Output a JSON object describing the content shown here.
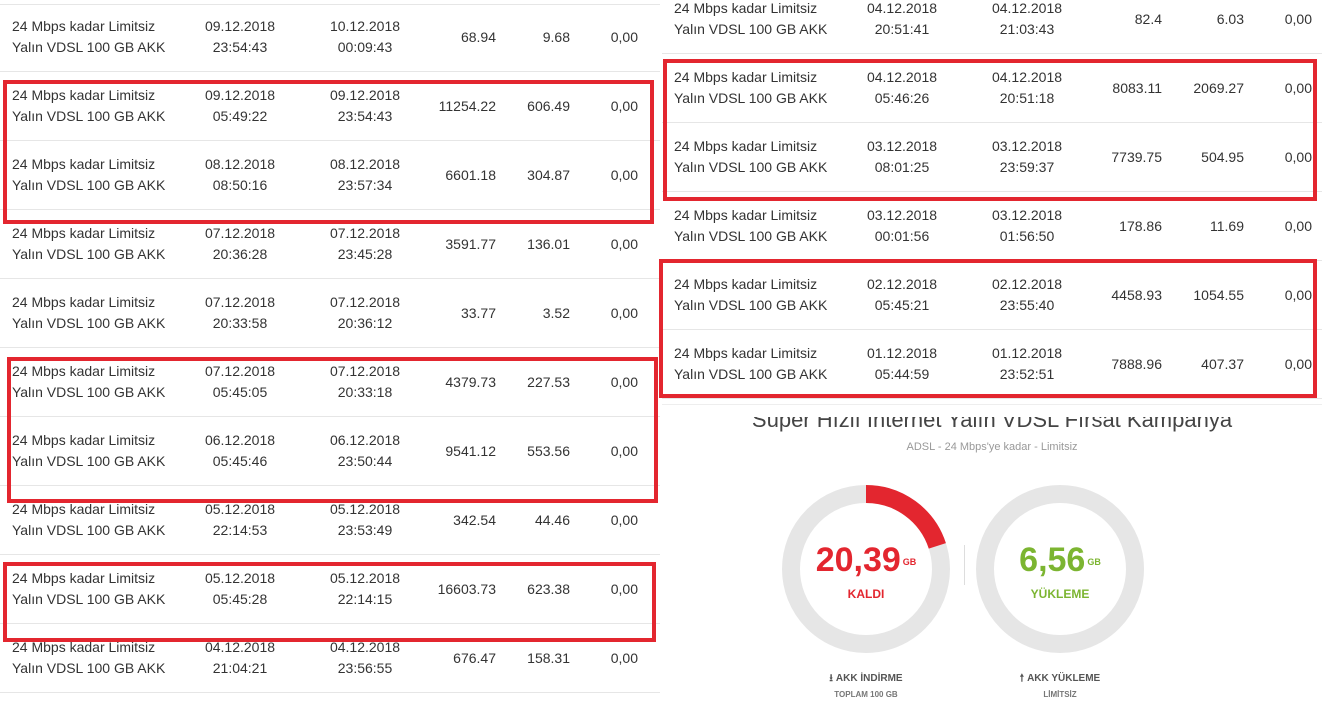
{
  "left_rows": [
    {
      "pkg1": "24 Mbps kadar Limitsiz",
      "pkg2": "Yalın VDSL 100 GB AKK",
      "sd": "09.12.2018",
      "st": "23:54:43",
      "ed": "10.12.2018",
      "et": "00:09:43",
      "dl": "68.94",
      "ul": "9.68",
      "fee": "0,00"
    },
    {
      "pkg1": "24 Mbps kadar Limitsiz",
      "pkg2": "Yalın VDSL 100 GB AKK",
      "sd": "09.12.2018",
      "st": "05:49:22",
      "ed": "09.12.2018",
      "et": "23:54:43",
      "dl": "11254.22",
      "ul": "606.49",
      "fee": "0,00"
    },
    {
      "pkg1": "24 Mbps kadar Limitsiz",
      "pkg2": "Yalın VDSL 100 GB AKK",
      "sd": "08.12.2018",
      "st": "08:50:16",
      "ed": "08.12.2018",
      "et": "23:57:34",
      "dl": "6601.18",
      "ul": "304.87",
      "fee": "0,00"
    },
    {
      "pkg1": "24 Mbps kadar Limitsiz",
      "pkg2": "Yalın VDSL 100 GB AKK",
      "sd": "07.12.2018",
      "st": "20:36:28",
      "ed": "07.12.2018",
      "et": "23:45:28",
      "dl": "3591.77",
      "ul": "136.01",
      "fee": "0,00"
    },
    {
      "pkg1": "24 Mbps kadar Limitsiz",
      "pkg2": "Yalın VDSL 100 GB AKK",
      "sd": "07.12.2018",
      "st": "20:33:58",
      "ed": "07.12.2018",
      "et": "20:36:12",
      "dl": "33.77",
      "ul": "3.52",
      "fee": "0,00"
    },
    {
      "pkg1": "24 Mbps kadar Limitsiz",
      "pkg2": "Yalın VDSL 100 GB AKK",
      "sd": "07.12.2018",
      "st": "05:45:05",
      "ed": "07.12.2018",
      "et": "20:33:18",
      "dl": "4379.73",
      "ul": "227.53",
      "fee": "0,00"
    },
    {
      "pkg1": "24 Mbps kadar Limitsiz",
      "pkg2": "Yalın VDSL 100 GB AKK",
      "sd": "06.12.2018",
      "st": "05:45:46",
      "ed": "06.12.2018",
      "et": "23:50:44",
      "dl": "9541.12",
      "ul": "553.56",
      "fee": "0,00"
    },
    {
      "pkg1": "24 Mbps kadar Limitsiz",
      "pkg2": "Yalın VDSL 100 GB AKK",
      "sd": "05.12.2018",
      "st": "22:14:53",
      "ed": "05.12.2018",
      "et": "23:53:49",
      "dl": "342.54",
      "ul": "44.46",
      "fee": "0,00"
    },
    {
      "pkg1": "24 Mbps kadar Limitsiz",
      "pkg2": "Yalın VDSL 100 GB AKK",
      "sd": "05.12.2018",
      "st": "05:45:28",
      "ed": "05.12.2018",
      "et": "22:14:15",
      "dl": "16603.73",
      "ul": "623.38",
      "fee": "0,00"
    },
    {
      "pkg1": "24 Mbps kadar Limitsiz",
      "pkg2": "Yalın VDSL 100 GB AKK",
      "sd": "04.12.2018",
      "st": "21:04:21",
      "ed": "04.12.2018",
      "et": "23:56:55",
      "dl": "676.47",
      "ul": "158.31",
      "fee": "0,00"
    }
  ],
  "right_rows": [
    {
      "pkg1": "24 Mbps kadar Limitsiz",
      "pkg2": "Yalın VDSL 100 GB AKK",
      "sd": "04.12.2018",
      "st": "20:51:41",
      "ed": "04.12.2018",
      "et": "21:03:43",
      "dl": "82.4",
      "ul": "6.03",
      "fee": "0,00"
    },
    {
      "pkg1": "24 Mbps kadar Limitsiz",
      "pkg2": "Yalın VDSL 100 GB AKK",
      "sd": "04.12.2018",
      "st": "05:46:26",
      "ed": "04.12.2018",
      "et": "20:51:18",
      "dl": "8083.11",
      "ul": "2069.27",
      "fee": "0,00"
    },
    {
      "pkg1": "24 Mbps kadar Limitsiz",
      "pkg2": "Yalın VDSL 100 GB AKK",
      "sd": "03.12.2018",
      "st": "08:01:25",
      "ed": "03.12.2018",
      "et": "23:59:37",
      "dl": "7739.75",
      "ul": "504.95",
      "fee": "0,00"
    },
    {
      "pkg1": "24 Mbps kadar Limitsiz",
      "pkg2": "Yalın VDSL 100 GB AKK",
      "sd": "03.12.2018",
      "st": "00:01:56",
      "ed": "03.12.2018",
      "et": "01:56:50",
      "dl": "178.86",
      "ul": "11.69",
      "fee": "0,00"
    },
    {
      "pkg1": "24 Mbps kadar Limitsiz",
      "pkg2": "Yalın VDSL 100 GB AKK",
      "sd": "02.12.2018",
      "st": "05:45:21",
      "ed": "02.12.2018",
      "et": "23:55:40",
      "dl": "4458.93",
      "ul": "1054.55",
      "fee": "0,00"
    },
    {
      "pkg1": "24 Mbps kadar Limitsiz",
      "pkg2": "Yalın VDSL 100 GB AKK",
      "sd": "01.12.2018",
      "st": "05:44:59",
      "ed": "01.12.2018",
      "et": "23:52:51",
      "dl": "7888.96",
      "ul": "407.37",
      "fee": "0,00"
    }
  ],
  "summary": {
    "campaign_title": "Süper Hızlı İnternet Yalın VDSL Fırsat Kampanya",
    "subtitle": "ADSL - 24 Mbps'ye kadar - Limitsiz",
    "download": {
      "value": "20,39",
      "unit": "GB",
      "label": "KALDI",
      "used_fraction": 0.2,
      "color": "#e3262f",
      "foot_title": "AKK İNDİRME",
      "foot_sub": "TOPLAM 100 GB",
      "icon": "download-icon"
    },
    "upload": {
      "value": "6,56",
      "unit": "GB",
      "label": "YÜKLEME",
      "used_fraction": 0,
      "color": "#7cb531",
      "foot_title": "AKK YÜKLEME",
      "foot_sub": "LİMİTSİZ",
      "icon": "upload-icon"
    }
  },
  "colors": {
    "highlight": "#e3262f",
    "gauge_track": "#e6e6e6"
  }
}
